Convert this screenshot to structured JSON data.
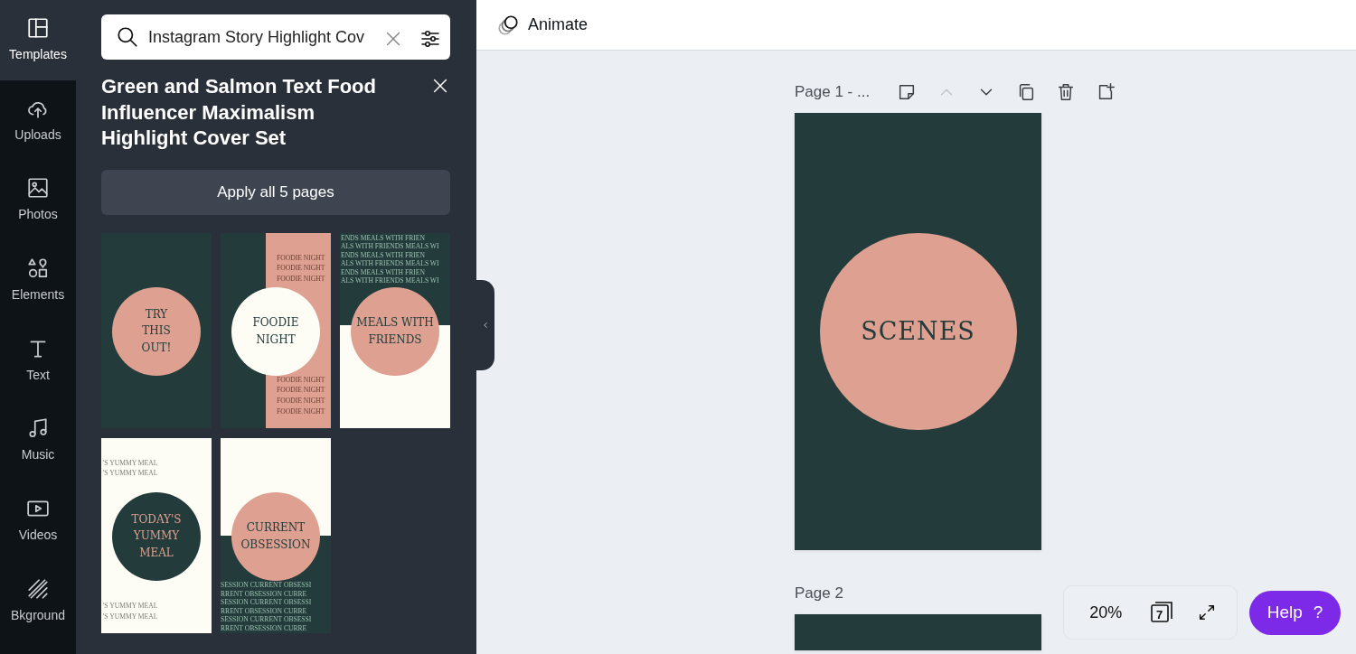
{
  "sidebar": {
    "items": [
      {
        "label": "Templates",
        "kind": "templates",
        "selected": true
      },
      {
        "label": "Uploads",
        "kind": "uploads",
        "selected": false
      },
      {
        "label": "Photos",
        "kind": "photos",
        "selected": false
      },
      {
        "label": "Elements",
        "kind": "elements",
        "selected": false
      },
      {
        "label": "Text",
        "kind": "text",
        "selected": false
      },
      {
        "label": "Music",
        "kind": "music",
        "selected": false
      },
      {
        "label": "Videos",
        "kind": "videos",
        "selected": false
      },
      {
        "label": "Bkground",
        "kind": "background",
        "selected": false
      }
    ]
  },
  "search": {
    "value": "Instagram Story Highlight Cov"
  },
  "template": {
    "title": "Green and Salmon Text Food Influencer Maximalism Highlight Cover Set",
    "apply_button": "Apply all 5 pages",
    "thumbnails": [
      {
        "kind": "plain",
        "circle_text": [
          "TRY",
          "THIS",
          "OUT!"
        ]
      },
      {
        "kind": "stripe",
        "circle_text": [
          "FOODIE",
          "NIGHT"
        ],
        "pattern_above": [
          "FOODIE NIGHT",
          "FOODIE NIGHT",
          "FOODIE NIGHT"
        ],
        "pattern_below": [
          "FOODIE NIGHT",
          "FOODIE NIGHT",
          "FOODIE NIGHT",
          "FOODIE NIGHT"
        ]
      },
      {
        "kind": "split-top",
        "circle_text": [
          "MEALS WITH",
          "FRIENDS"
        ],
        "pattern_above": [
          "ENDS MEALS WITH FRIEN",
          "ALS WITH FRIENDS MEALS WI",
          "ENDS MEALS WITH FRIEN",
          "ALS WITH FRIENDS MEALS WI",
          "ENDS MEALS WITH FRIEN",
          "ALS WITH FRIENDS MEALS WI"
        ]
      },
      {
        "kind": "left-pattern",
        "circle_text": [
          "TODAY'S",
          "YUMMY",
          "MEAL"
        ],
        "pattern_above": [
          "'S YUMMY MEAL",
          "'S YUMMY MEAL"
        ],
        "pattern_below": [
          "'S YUMMY MEAL",
          "'S YUMMY MEAL"
        ]
      },
      {
        "kind": "split-bottom",
        "circle_text": [
          "CURRENT",
          "OBSESSION"
        ],
        "pattern_below": [
          "SESSION CURRENT OBSESSI",
          "RRENT OBSESSION CURRE",
          "SESSION CURRENT OBSESSI",
          "RRENT OBSESSION CURRE",
          "SESSION CURRENT OBSESSI",
          "RRENT OBSESSION CURRE"
        ]
      }
    ]
  },
  "toolbar": {
    "animate": "Animate"
  },
  "page_actions": [
    {
      "kind": "notes",
      "disabled": false
    },
    {
      "kind": "up",
      "disabled": true
    },
    {
      "kind": "down",
      "disabled": false
    },
    {
      "kind": "duplicate",
      "disabled": false
    },
    {
      "kind": "delete",
      "disabled": false
    },
    {
      "kind": "add",
      "disabled": false
    }
  ],
  "pages": [
    {
      "label": "Page 1 - ...",
      "text": "SCENES"
    },
    {
      "label": "Page 2"
    }
  ],
  "zoom": {
    "value": "20%",
    "page_count": "7"
  },
  "help": {
    "label": "Help",
    "icon": "?"
  }
}
